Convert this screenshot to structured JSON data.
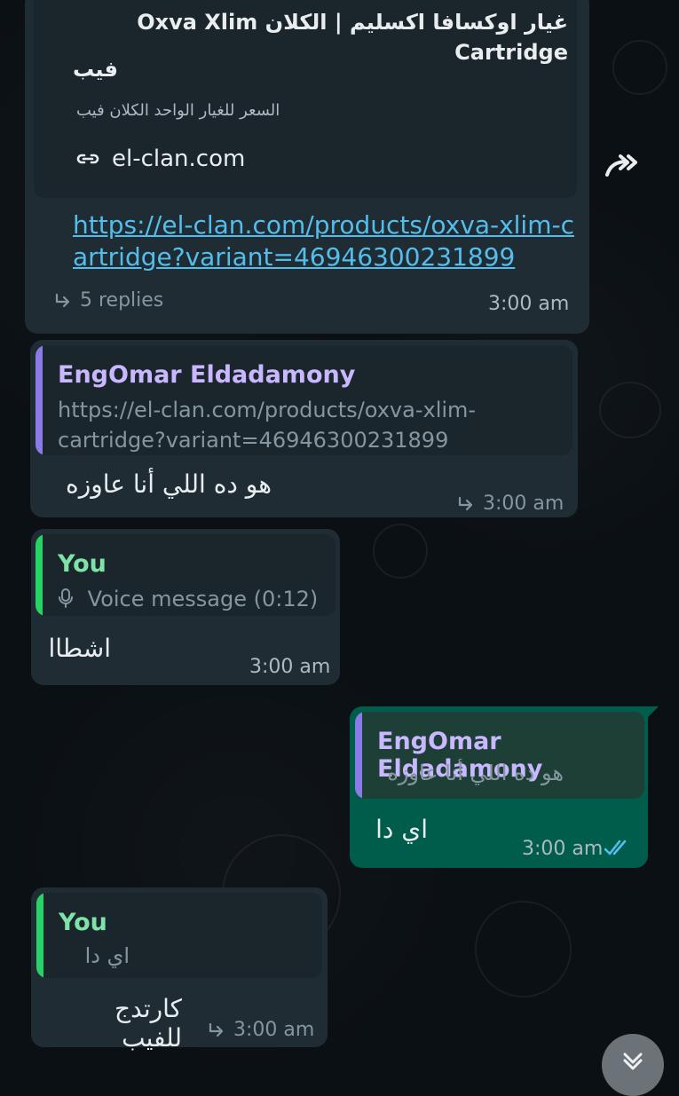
{
  "messages": {
    "link_preview": {
      "title_line_1": "غيار اوكسافا اكسليم | الكلان Oxva Xlim Cartridge",
      "title_line_2": "فيب",
      "description": "السعر للغيار الواحد الكلان فيب",
      "domain": "el-clan.com",
      "url": "https://el-clan.com/products/oxva-xlim-cartridge?variant=46946300231899",
      "replies": "5 replies",
      "time": "3:00 am"
    },
    "message_2": {
      "quoted_name": "EngOmar Eldadamony",
      "quoted_text": "https://el-clan.com/products/oxva-xlim-cartridge?variant=46946300231899",
      "text": "هو ده اللي أنا عاوزه",
      "time": "3:00 am"
    },
    "message_3": {
      "quoted_name": "You",
      "quoted_text": "Voice message (0:12)",
      "text": "اشطاا",
      "time": "3:00 am"
    },
    "message_4": {
      "quoted_name": "EngOmar Eldadamony",
      "quoted_text": "هو ده اللي أنا عاوزه",
      "text": "اي دا",
      "time": "3:00 am"
    },
    "message_5": {
      "quoted_name": "You",
      "quoted_text": "اي دا",
      "text": "كارتدج للفيب",
      "time": "3:00 am"
    }
  },
  "icons": {
    "forward": "forward-icon",
    "link": "link-icon",
    "reply": "reply-icon",
    "microphone": "microphone-icon",
    "read": "double-check-icon",
    "scroll_down": "chevron-down-icon"
  },
  "colors": {
    "background": "#0b1014",
    "incoming": "#1f2c33",
    "outgoing": "#005c4b",
    "link": "#53bdeb",
    "purple_author": "#c9b8ff",
    "green_author": "#7de3a6"
  }
}
